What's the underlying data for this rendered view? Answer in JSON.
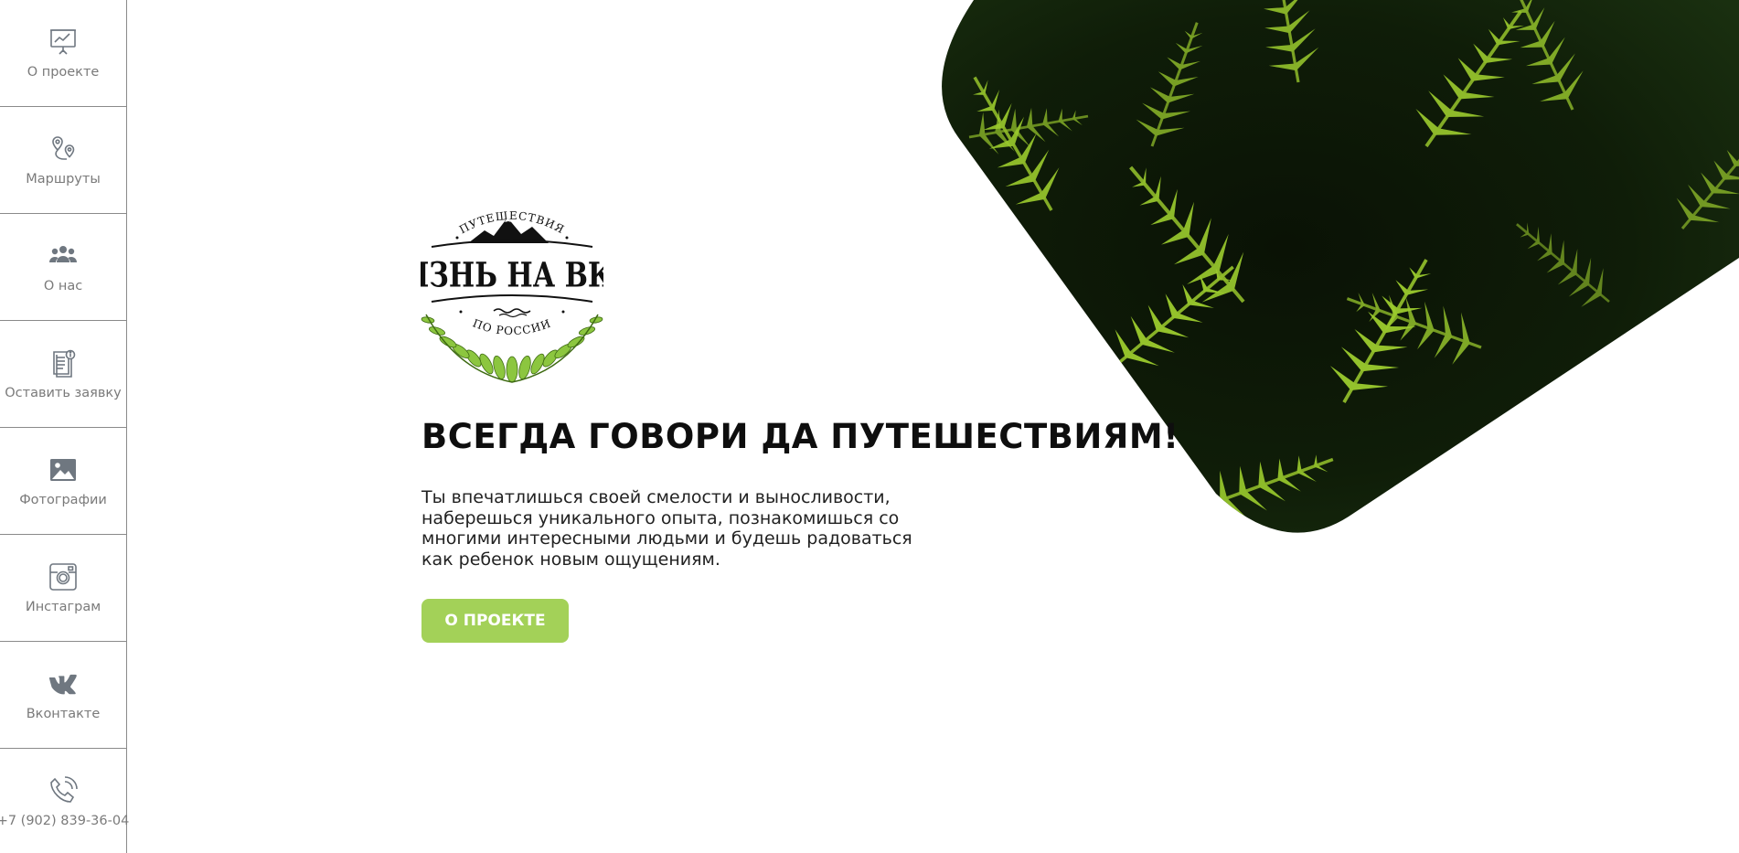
{
  "sidebar": {
    "items": [
      {
        "label": "О проекте",
        "icon": "presentation-chart-icon"
      },
      {
        "label": "Маршруты",
        "icon": "route-pins-icon"
      },
      {
        "label": "О нас",
        "icon": "team-icon"
      },
      {
        "label": "Оставить заявку",
        "icon": "document-info-icon"
      },
      {
        "label": "Фотографии",
        "icon": "image-icon"
      },
      {
        "label": "Инстаграм",
        "icon": "instagram-icon"
      },
      {
        "label": "Вконтакте",
        "icon": "vk-icon"
      },
      {
        "label": "+7 (902) 839-36-04",
        "icon": "phone-icon"
      }
    ]
  },
  "logo": {
    "top_text": "ПУТЕШЕСТВИЯ",
    "main_text": "ЖИЗНЬ НА ВКУС",
    "bottom_text": "ПО РОССИИ"
  },
  "hero": {
    "title": "ВСЕГДА ГОВОРИ ДА ПУТЕШЕСТВИЯМ!",
    "text": "Ты впечатлишься своей смелости и выносливости, наберешься уникального опыта, познакомишься со многими интересными людьми и будешь радоваться как ребенок новым ощущениям.",
    "button_label": "О ПРОЕКТЕ"
  },
  "colors": {
    "accent": "#a3d158",
    "sidebar_text": "#7a7a7a",
    "icon": "#6f7780"
  }
}
